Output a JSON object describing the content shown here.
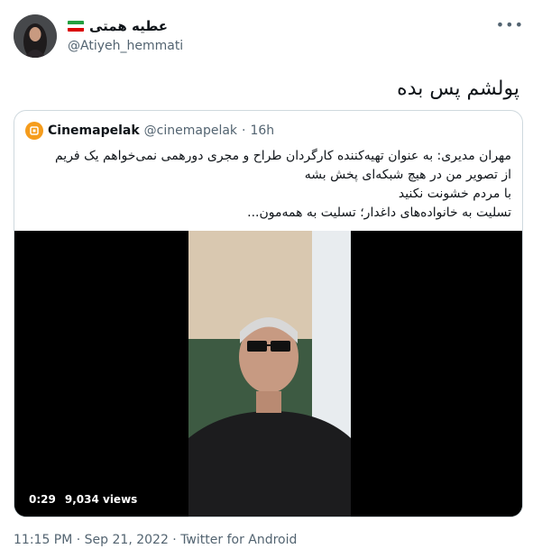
{
  "author": {
    "display_name": "عطیه همتی",
    "handle": "@Atiyeh_hemmati",
    "flag_icon": "iran-flag-icon"
  },
  "tweet_text": "پولشم پس بده",
  "quoted": {
    "name": "Cinemapelak",
    "handle": "@cinemapelak",
    "separator": "·",
    "time": "16h",
    "text_lines": [
      "مهران مدیری: به عنوان تهیه‌کننده کارگردان طراح و مجری دورهمی نمی‌خواهم یک فریم",
      "از تصویر من در هیچ شبکه‌ای پخش بشه",
      "با مردم خشونت نکنید",
      "تسلیت به خانواده‌های داغدار؛ تسلیت به همه‌مون..."
    ],
    "video": {
      "duration": "0:29",
      "views": "9,034 views"
    }
  },
  "footer": "11:15 PM · Sep 21, 2022 · Twitter for Android",
  "more_icon": "more-icon",
  "colors": {
    "secondary_text": "#536471",
    "brand_orange": "#f59c1c",
    "border": "#cfd9de"
  }
}
